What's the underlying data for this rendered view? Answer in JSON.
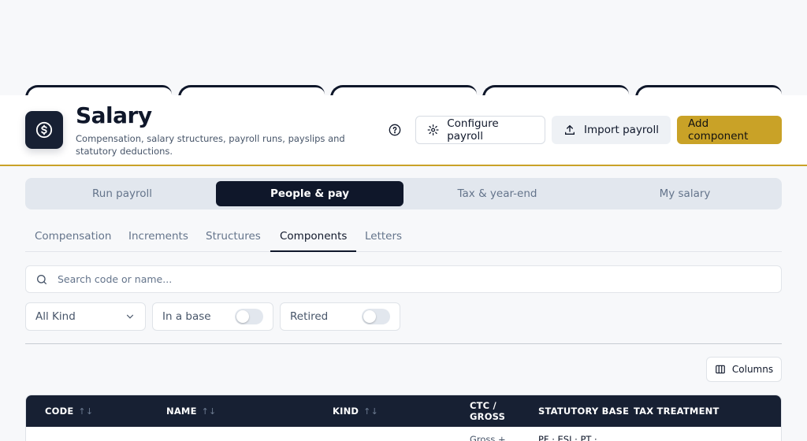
{
  "header": {
    "title": "Salary",
    "subtitle": "Compensation, salary structures, payroll runs, payslips and statutory deductions."
  },
  "actions": {
    "configure": "Configure payroll",
    "import": "Import payroll",
    "add": "Add component"
  },
  "segments": [
    "Run payroll",
    "People & pay",
    "Tax & year-end",
    "My salary"
  ],
  "active_segment": "People & pay",
  "subtabs": [
    "Compensation",
    "Increments",
    "Structures",
    "Components",
    "Letters"
  ],
  "active_subtab": "Components",
  "search": {
    "placeholder": "Search code or name..."
  },
  "filters": {
    "kind": "All Kind",
    "in_base": "In a base",
    "retired": "Retired"
  },
  "columns_button": "Columns",
  "table": {
    "headers": [
      "CODE",
      "NAME",
      "KIND",
      "CTC / GROSS",
      "STATUTORY BASE",
      "TAX TREATMENT"
    ],
    "ctc_line1": "CTC /",
    "ctc_line2": "GROSS",
    "first_row": {
      "ctc": "Gross +",
      "statutory": "PF · ESI · PT ·"
    }
  },
  "colors": {
    "accent": "#c9a227",
    "navy": "#172033"
  }
}
